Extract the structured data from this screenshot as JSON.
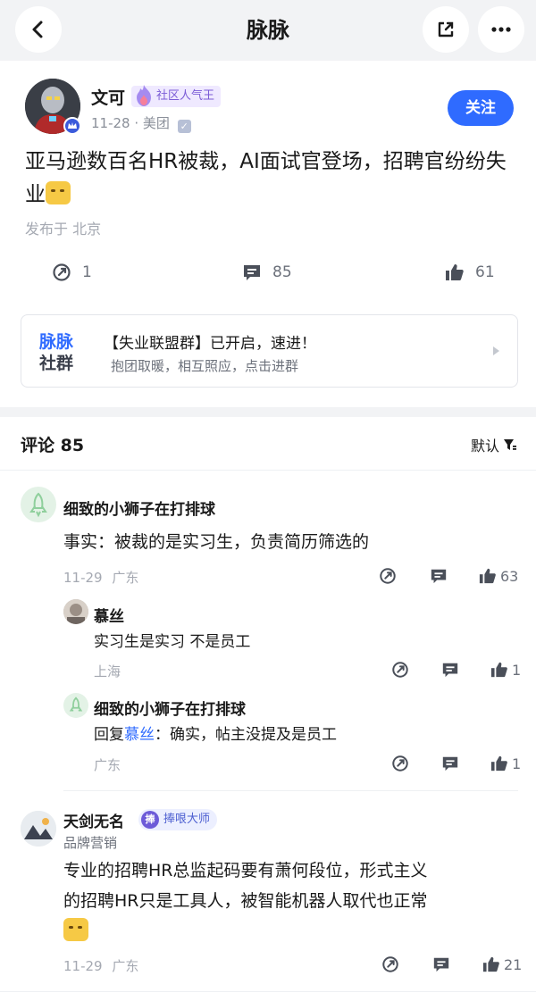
{
  "nav": {
    "title": "脉脉",
    "back_icon": "chevron-left-icon",
    "share_icon": "share-icon",
    "more_icon": "more-icon"
  },
  "post": {
    "author": "文可",
    "badge": "社区人气王",
    "date": "11-28",
    "company": "· 美团",
    "follow_label": "关注",
    "text": "亚马逊数百名HR被裁，AI面试官登场，招聘官纷纷失业",
    "location": "发布于 北京",
    "stats": {
      "reposts": "1",
      "comments": "85",
      "likes": "61"
    }
  },
  "community": {
    "logo_line1": "脉脉",
    "logo_line2": "社群",
    "title": "【失业联盟群】已开启，速进！",
    "subtitle": "抱团取暖，相互照应，点击进群"
  },
  "comments_header": {
    "label": "评论 85",
    "sort_label": "默认"
  },
  "comments": [
    {
      "name": "细致的小狮子在打排球",
      "text": "事实：被裁的是实习生，负责简历筛选的",
      "date": "11-29",
      "region": "广东",
      "likes": "63",
      "replies": [
        {
          "name": "慕丝",
          "text": "实习生是实习 不是员工",
          "region": "上海",
          "likes": "1"
        },
        {
          "name": "细致的小狮子在打排球",
          "reply_prefix": "回复",
          "mention": "慕丝",
          "reply_text": "：确实，帖主没提及是员工",
          "region": "广东",
          "likes": "1"
        }
      ]
    },
    {
      "name": "天剑无名",
      "badge": "捧哏大师",
      "badge_char": "捧",
      "title": "品牌营销",
      "text_line1": "专业的招聘HR总监起码要有萧何段位，形式主义",
      "text_line2": "的招聘HR只是工具人，被智能机器人取代也正常",
      "date": "11-29",
      "region": "广东",
      "likes": "21"
    }
  ],
  "colors": {
    "accent": "#2f6bff",
    "badge_purple": "#7b5cd6",
    "muted": "#a5a9b2"
  }
}
